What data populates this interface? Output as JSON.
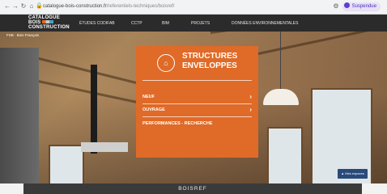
{
  "browser": {
    "url_domain": "catalogue-bois-construction.fr",
    "url_path": "/referentiels-techniques/boisref/",
    "profile_label": "Suspendue"
  },
  "site": {
    "logo_lines": [
      "CATALOGUE",
      "BOIS",
      "CONSTRUCTION"
    ],
    "nav": [
      "ÉTUDES CODIFAB",
      "CCTP",
      "BIM",
      "PROJETS",
      "DONNÉES ENVIRONNEMENTALES"
    ],
    "breadcrumb": "FSB · Bois Français"
  },
  "panel": {
    "title_line1": "STRUCTURES",
    "title_line2": "ENVELOPPES",
    "items": [
      {
        "label": "NEUF",
        "has_chevron": true
      },
      {
        "label": "OUVRAGE",
        "has_chevron": true
      },
      {
        "label": "PERFORMANCES - RECHERCHE",
        "has_chevron": false
      }
    ],
    "accent": "#e06a27"
  },
  "help_button": "Mes espaces",
  "footer_title": "BOISREF"
}
